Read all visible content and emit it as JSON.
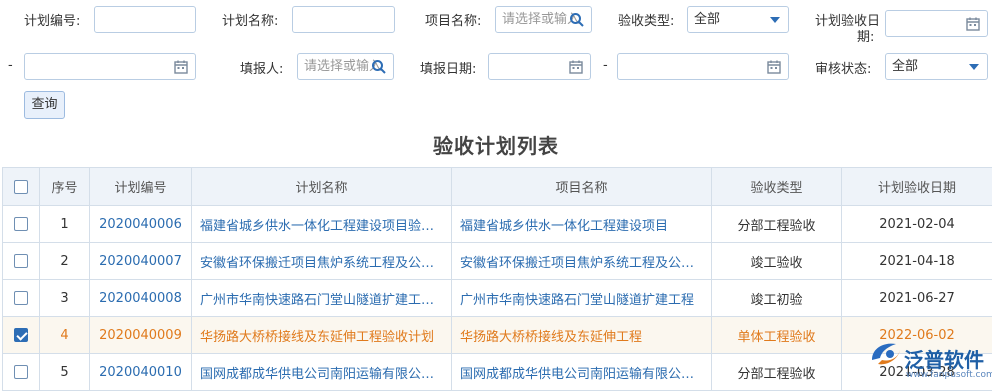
{
  "filters": {
    "plan_no_label": "计划编号:",
    "plan_name_label": "计划名称:",
    "project_name_label": "项目名称:",
    "project_name_placeholder": "请选择或输入",
    "accept_type_label": "验收类型:",
    "accept_type_value": "全部",
    "plan_date_label_1": "计划验收日",
    "plan_date_label_2": "期:",
    "dash": "-",
    "filler_label": "填报人:",
    "filler_placeholder": "请选择或输入",
    "fill_date_label": "填报日期:",
    "audit_label": "审核状态:",
    "audit_value": "全部",
    "query_button": "查询"
  },
  "table": {
    "title": "验收计划列表",
    "headers": [
      "序号",
      "计划编号",
      "计划名称",
      "项目名称",
      "验收类型",
      "计划验收日期"
    ],
    "rows": [
      {
        "idx": "1",
        "no": "2020040006",
        "plan": "福建省城乡供水一体化工程建设项目验收计划",
        "project": "福建省城乡供水一体化工程建设项目",
        "type": "分部工程验收",
        "date": "2021-02-04",
        "checked": false
      },
      {
        "idx": "2",
        "no": "2020040007",
        "plan": "安徽省环保搬迁项目焦炉系统工程及公辅工程验收计划",
        "project": "安徽省环保搬迁项目焦炉系统工程及公辅工程",
        "type": "竣工验收",
        "date": "2021-04-18",
        "checked": false
      },
      {
        "idx": "3",
        "no": "2020040008",
        "plan": "广州市华南快速路石门堂山隧道扩建工程验收计划",
        "project": "广州市华南快速路石门堂山隧道扩建工程",
        "type": "竣工初验",
        "date": "2021-06-27",
        "checked": false
      },
      {
        "idx": "4",
        "no": "2020040009",
        "plan": "华扬路大桥桥接线及东延伸工程验收计划",
        "project": "华扬路大桥桥接线及东延伸工程",
        "type": "单体工程验收",
        "date": "2022-06-02",
        "checked": true
      },
      {
        "idx": "5",
        "no": "2020040010",
        "plan": "国网成都成华供电公司南阳运输有限公司验收计划",
        "project": "国网成都成华供电公司南阳运输有限公司工程",
        "type": "分部工程验收",
        "date": "2021-03-28",
        "checked": false
      }
    ]
  },
  "logo": {
    "text": "泛普软件",
    "watermark": "www.fanpusoft.com"
  },
  "colors": {
    "accent": "#2d6db5",
    "link": "#2b6cb0",
    "selected_text": "#e07a1c",
    "header_bg": "#eef3f9"
  }
}
